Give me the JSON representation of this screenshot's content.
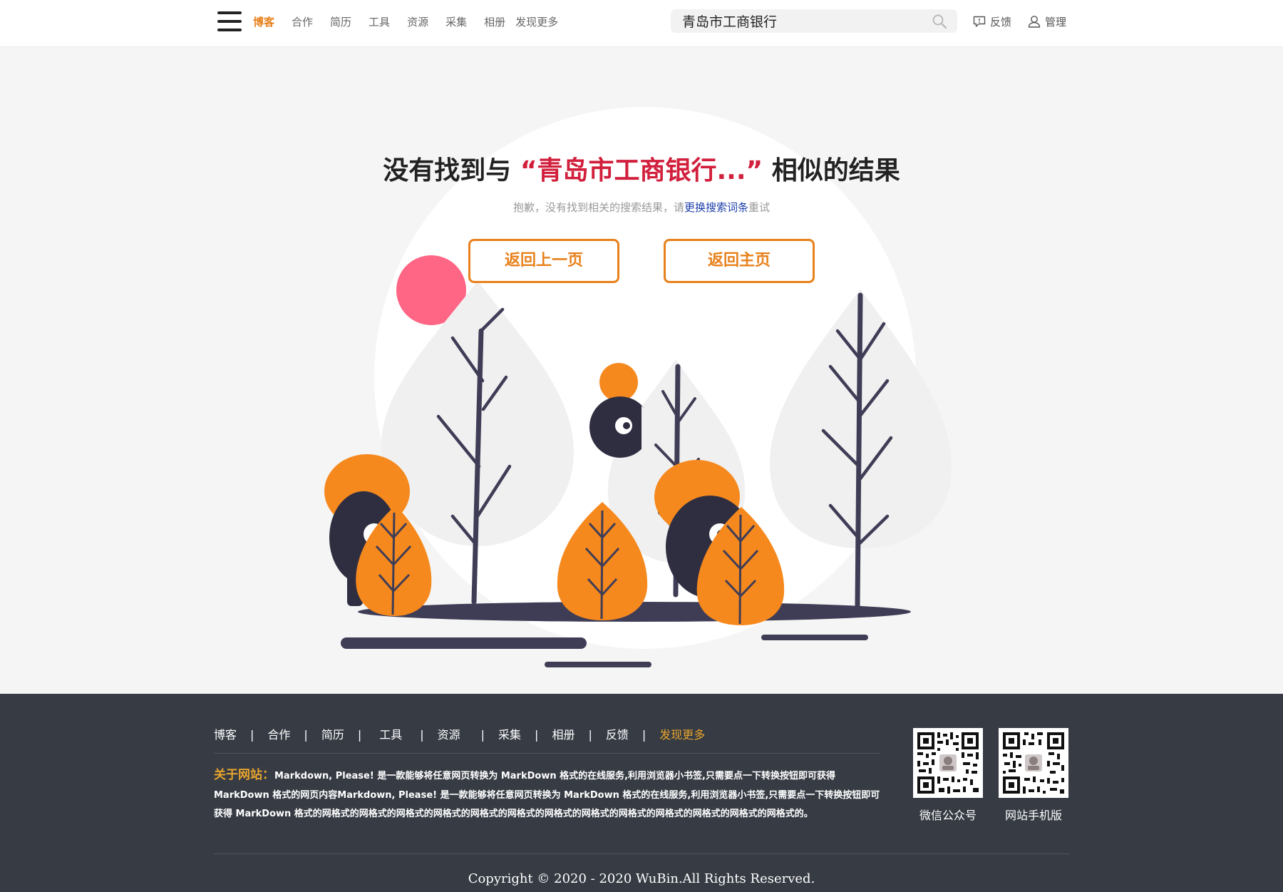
{
  "header": {
    "nav": [
      {
        "label": "博客",
        "active": true
      },
      {
        "label": "合作"
      },
      {
        "label": "简历"
      },
      {
        "label": "工具"
      },
      {
        "label": "资源"
      },
      {
        "label": "采集"
      },
      {
        "label": "相册"
      },
      {
        "label": "发现更多"
      }
    ],
    "search_value": "青岛市工商银行",
    "feedback_label": "反馈",
    "admin_label": "管理"
  },
  "main": {
    "title_prefix": "没有找到与",
    "title_keyword": "“青岛市工商银行...”",
    "title_suffix": "相似的结果",
    "subtitle_prefix": "抱歉，没有找到相关的搜索结果，请",
    "subtitle_link": "更换搜索词条",
    "subtitle_suffix": "重试",
    "back_button": "返回上一页",
    "home_button": "返回主页"
  },
  "footer": {
    "nav": [
      {
        "label": "博客"
      },
      {
        "label": "合作"
      },
      {
        "label": "简历"
      },
      {
        "label": "工具"
      },
      {
        "label": "资源"
      },
      {
        "label": "采集"
      },
      {
        "label": "相册"
      },
      {
        "label": "反馈"
      },
      {
        "label": "发现更多",
        "highlight": true
      }
    ],
    "separator": "|",
    "about_label": "关于网站：",
    "about_text": "Markdown, Please! 是一款能够将任意网页转换为 MarkDown 格式的在线服务,利用浏览器小书签,只需要点一下转换按钮即可获得 MarkDown 格式的网页内容Markdown, Please! 是一款能够将任意网页转换为 MarkDown 格式的在线服务,利用浏览器小书签,只需要点一下转换按钮即可获得 MarkDown 格式的网格式的网格式的网格式的网格式的网格式的网格式的网格式的网格式的网格式的网格式的网格式的网格式的网格式的。",
    "qr_codes": [
      {
        "caption": "微信公众号"
      },
      {
        "caption": "网站手机版"
      }
    ],
    "copyright": "Copyright © 2020 - 2020 WuBin.All Rights Reserved."
  },
  "colors": {
    "accent": "#e8811c",
    "keyword": "#d11f3c",
    "link": "#1a3ca8",
    "footer_bg": "#363b44",
    "footer_highlight": "#e8a42e"
  },
  "icons": [
    "menu-icon",
    "search-icon",
    "feedback-icon",
    "user-icon",
    "qr-code-image"
  ]
}
